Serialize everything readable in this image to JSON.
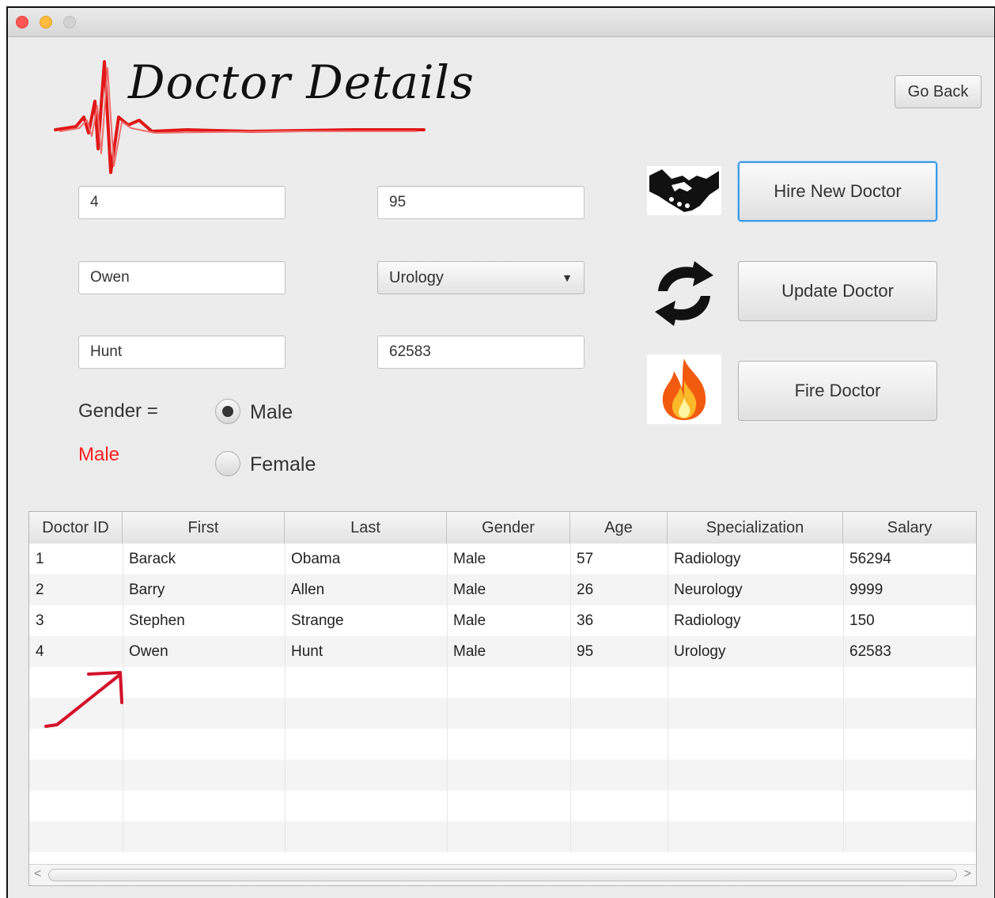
{
  "app": {
    "title": "Doctor Details"
  },
  "header": {
    "go_back_label": "Go Back"
  },
  "form": {
    "id_value": "4",
    "first_value": "Owen",
    "last_value": "Hunt",
    "age_value": "95",
    "specialization_value": "Urology",
    "salary_value": "62583",
    "gender_label": "Gender =",
    "gender_status": "Male",
    "radio_male_label": "Male",
    "radio_female_label": "Female",
    "selected_gender": "Male"
  },
  "actions": {
    "hire_label": "Hire New Doctor",
    "update_label": "Update Doctor",
    "fire_label": "Fire Doctor",
    "hire_icon": "handshake-icon",
    "update_icon": "refresh-icon",
    "fire_icon": "fire-icon"
  },
  "table": {
    "columns": [
      "Doctor ID",
      "First",
      "Last",
      "Gender",
      "Age",
      "Specialization",
      "Salary"
    ],
    "rows": [
      [
        "1",
        "Barack",
        "Obama",
        "Male",
        "57",
        "Radiology",
        "56294"
      ],
      [
        "2",
        "Barry",
        "Allen",
        "Male",
        "26",
        "Neurology",
        "9999"
      ],
      [
        "3",
        "Stephen",
        "Strange",
        "Male",
        "36",
        "Radiology",
        "150"
      ],
      [
        "4",
        "Owen",
        "Hunt",
        "Male",
        "95",
        "Urology",
        "62583"
      ]
    ]
  },
  "colors": {
    "gender_status": "#ff2020",
    "annotation_arrow": "#d4112a",
    "logo_red": "#e01818",
    "focus_blue": "#3d9be3"
  }
}
